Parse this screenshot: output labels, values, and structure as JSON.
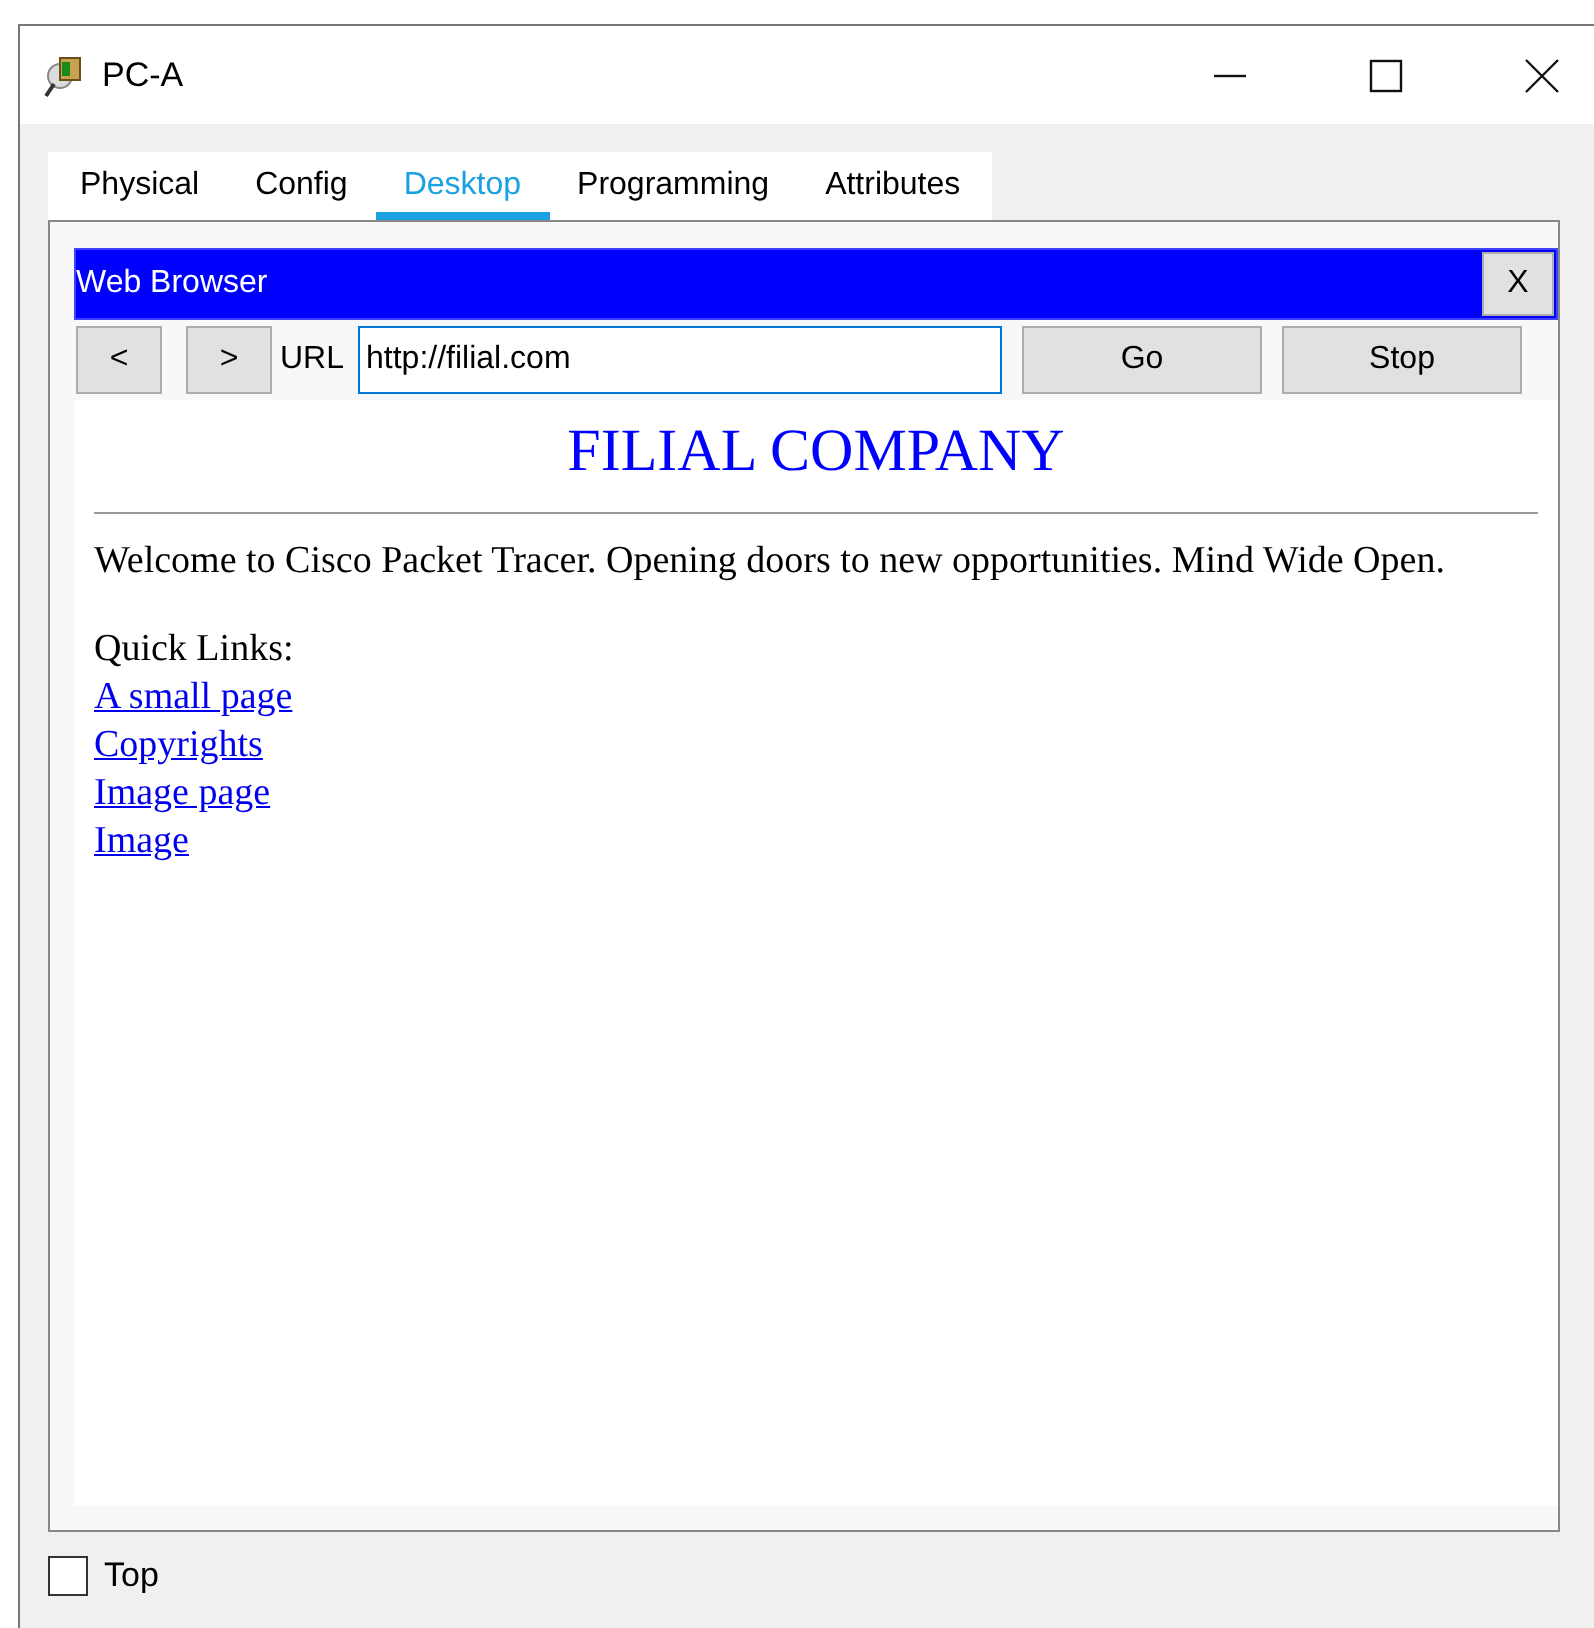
{
  "window": {
    "title": "PC-A"
  },
  "tabs": [
    {
      "label": "Physical",
      "selected": false
    },
    {
      "label": "Config",
      "selected": false
    },
    {
      "label": "Desktop",
      "selected": true
    },
    {
      "label": "Programming",
      "selected": false
    },
    {
      "label": "Attributes",
      "selected": false
    }
  ],
  "browser": {
    "title": "Web Browser",
    "close_label": "X",
    "back_label": "<",
    "forward_label": ">",
    "url_label": "URL",
    "url": "http://filial.com",
    "go_label": "Go",
    "stop_label": "Stop",
    "page": {
      "heading": "FILIAL COMPANY",
      "welcome": "Welcome to Cisco Packet Tracer. Opening doors to new opportunities. Mind Wide Open.",
      "links_label": "Quick Links:",
      "links": [
        "A small page",
        "Copyrights",
        "Image page",
        "Image"
      ]
    }
  },
  "top_checkbox": {
    "label": "Top",
    "checked": false
  }
}
